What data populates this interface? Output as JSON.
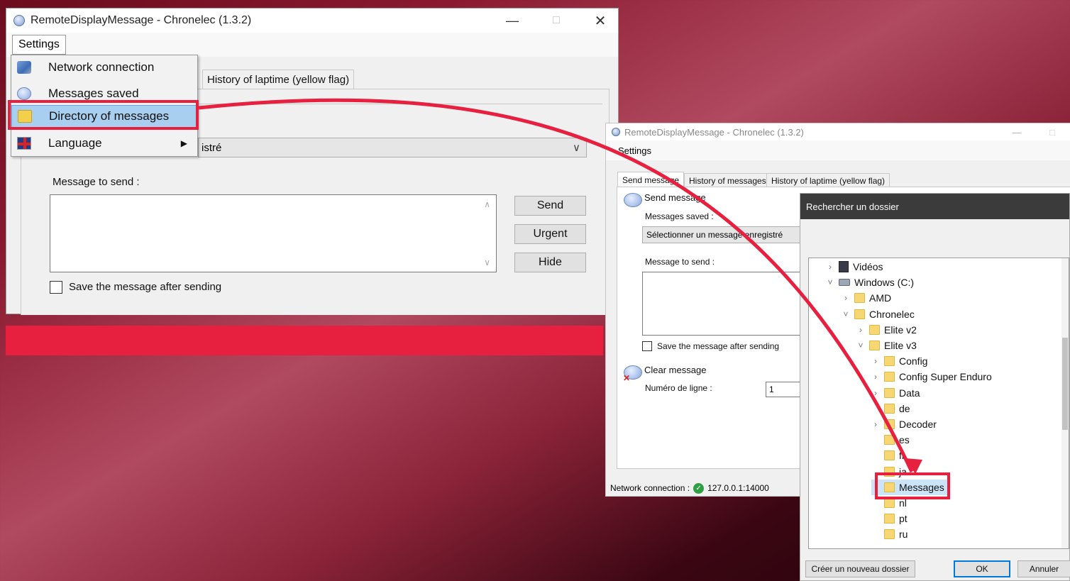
{
  "colors": {
    "accent_red": "#e8203f",
    "menu_highlight": "#cce4f7",
    "ok_border": "#0078d7"
  },
  "win1": {
    "title": "RemoteDisplayMessage - Chronelec (1.3.2)",
    "menu_settings": "Settings",
    "dropdown": {
      "items": [
        {
          "label": "Network connection",
          "icon": "network-icon"
        },
        {
          "label": "Messages saved",
          "icon": "speech-bubble-icon"
        },
        {
          "label": "Directory of messages",
          "icon": "folder-icon"
        },
        {
          "label": "Language",
          "icon": "uk-flag-icon"
        }
      ]
    },
    "tab_laptime": "History of laptime (yellow flag)",
    "select_fragment": "istré",
    "message_label": "Message to send :",
    "send": "Send",
    "urgent": "Urgent",
    "hide": "Hide",
    "save_after": "Save the message after sending"
  },
  "win2": {
    "title": "RemoteDisplayMessage - Chronelec (1.3.2)",
    "menu_settings": "Settings",
    "tabs": [
      "Send message",
      "History of messages",
      "History of laptime (yellow flag)"
    ],
    "group_send": "Send message",
    "messages_saved_label": "Messages saved :",
    "select_value": "Sélectionner un message enregistré",
    "message_label": "Message to send :",
    "save_after": "Save the message after sending",
    "group_clear": "Clear message",
    "line_number_label": "Numéro de ligne :",
    "line_number_value": "1",
    "status_label": "Network connection :",
    "status_value": "127.0.0.1:14000"
  },
  "folder_dialog": {
    "title": "Rechercher un dossier",
    "tree": [
      {
        "label": "Vidéos",
        "icon": "video-folder-icon",
        "chev": ">"
      },
      {
        "label": "Windows (C:)",
        "icon": "drive-icon",
        "chev": "v"
      },
      {
        "label": "AMD",
        "icon": "folder-icon",
        "chev": ">"
      },
      {
        "label": "Chronelec",
        "icon": "folder-icon",
        "chev": "v"
      },
      {
        "label": "Elite v2",
        "icon": "folder-icon",
        "chev": ">"
      },
      {
        "label": "Elite v3",
        "icon": "folder-icon",
        "chev": "v"
      },
      {
        "label": "Config",
        "icon": "folder-icon",
        "chev": ">"
      },
      {
        "label": "Config Super Enduro",
        "icon": "folder-icon",
        "chev": ">"
      },
      {
        "label": "Data",
        "icon": "folder-icon",
        "chev": ">"
      },
      {
        "label": "de",
        "icon": "folder-icon",
        "chev": ""
      },
      {
        "label": "Decoder",
        "icon": "folder-icon",
        "chev": ">"
      },
      {
        "label": "es",
        "icon": "folder-icon",
        "chev": ""
      },
      {
        "label": "fr",
        "icon": "folder-icon",
        "chev": ""
      },
      {
        "label": "ja",
        "icon": "folder-icon",
        "chev": ""
      },
      {
        "label": "Messages",
        "icon": "folder-icon",
        "chev": ""
      },
      {
        "label": "nl",
        "icon": "folder-icon",
        "chev": ""
      },
      {
        "label": "pt",
        "icon": "folder-icon",
        "chev": ""
      },
      {
        "label": "ru",
        "icon": "folder-icon",
        "chev": ""
      }
    ],
    "new_folder": "Créer un nouveau dossier",
    "ok": "OK",
    "cancel": "Annuler"
  }
}
